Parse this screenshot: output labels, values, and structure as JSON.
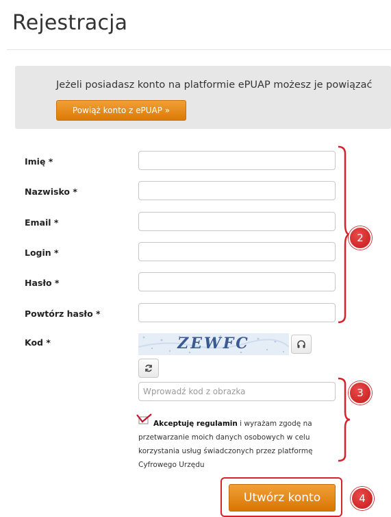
{
  "page_title": "Rejestracja",
  "epuap": {
    "text": "Jeżeli posiadasz konto na platformie ePUAP możesz je powiązać",
    "button": "Powiąż konto z ePUAP »"
  },
  "fields": [
    {
      "label": "Imię *",
      "value": ""
    },
    {
      "label": "Nazwisko *",
      "value": ""
    },
    {
      "label": "Email *",
      "value": ""
    },
    {
      "label": "Login *",
      "value": ""
    },
    {
      "label": "Hasło *",
      "value": ""
    },
    {
      "label": "Powtórz hasło *",
      "value": ""
    }
  ],
  "captcha": {
    "label": "Kod *",
    "image_text": "ZEWFC",
    "input_placeholder": "Wprowadź kod z obrazka",
    "audio_icon": "headphones-icon",
    "refresh_icon": "refresh-icon"
  },
  "terms": {
    "link": "Akceptuję regulamin",
    "text": " i wyrażam zgodę na przetwarzanie moich danych osobowych w celu korzystania usług świadczonych przez platformę Cyfrowego Urzędu",
    "checkbox_checked": true
  },
  "submit_label": "Utwórz konto",
  "annotations": {
    "badge_2": "2",
    "badge_3": "3",
    "badge_4": "4",
    "color": "#d8212a"
  },
  "colors": {
    "accent": "#e08a1e",
    "panel": "#e7e7e7"
  }
}
